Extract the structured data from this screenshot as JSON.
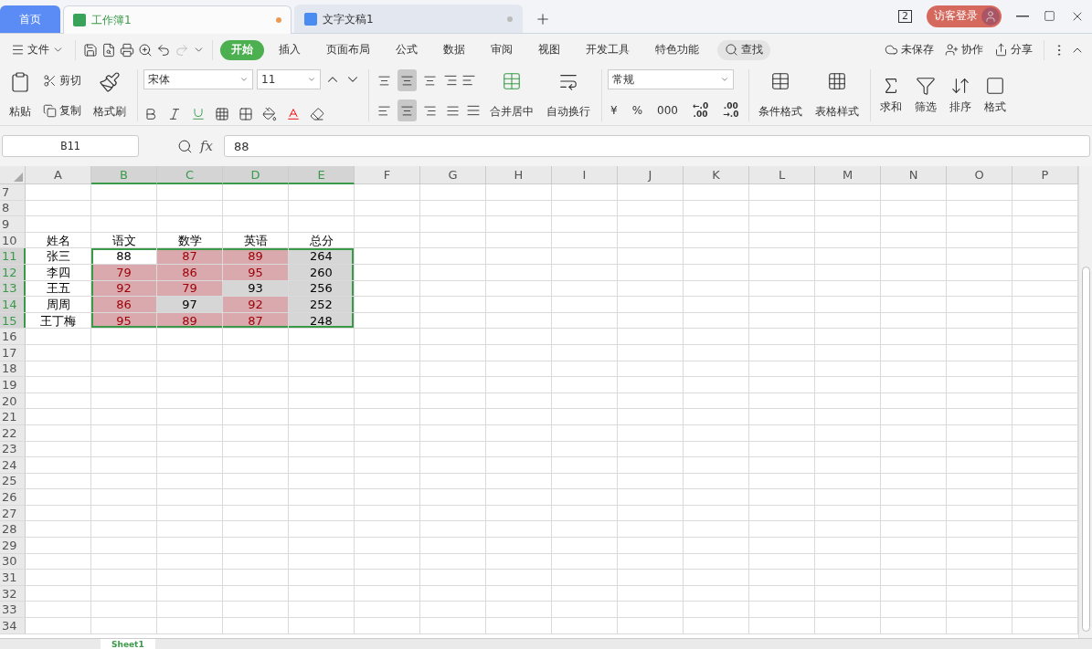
{
  "tabs": [
    {
      "kind": "home",
      "label": "首页",
      "selected": false
    },
    {
      "kind": "sheet",
      "label": "工作簿1",
      "selected": true,
      "unsaved": true
    },
    {
      "kind": "doc",
      "label": "文字文稿1",
      "selected": false,
      "unsaved": false
    }
  ],
  "window_count": "2",
  "login": "访客登录",
  "menu": {
    "file": "文件",
    "tabs": [
      {
        "label": "开始",
        "selected": true
      },
      {
        "label": "插入",
        "selected": false
      },
      {
        "label": "页面布局",
        "selected": false
      },
      {
        "label": "公式",
        "selected": false
      },
      {
        "label": "数据",
        "selected": false
      },
      {
        "label": "审阅",
        "selected": false
      },
      {
        "label": "视图",
        "selected": false
      },
      {
        "label": "开发工具",
        "selected": false
      },
      {
        "label": "特色功能",
        "selected": false
      }
    ],
    "search": "查找",
    "unsaved": "未保存",
    "collab": "协作",
    "share": "分享"
  },
  "toolbar": {
    "paste": "粘贴",
    "cut": "剪切",
    "copy": "复制",
    "format_painter": "格式刷",
    "font_name": "宋体",
    "font_size": "11",
    "vertical_align": [
      {
        "selected": false
      },
      {
        "selected": true
      },
      {
        "selected": false
      }
    ],
    "horizontal_align": [
      {
        "selected": false
      },
      {
        "selected": true
      },
      {
        "selected": false
      },
      {
        "selected": false
      }
    ],
    "merge": "合并居中",
    "wrap": "自动换行",
    "number_format": "常规",
    "number_buttons": [
      "¥",
      "%",
      "000"
    ],
    "decimals": [
      {
        "top": "←.0",
        "bottom": ".00"
      },
      {
        "top": ".00",
        "bottom": "→.0"
      }
    ],
    "cells": [
      "条件格式",
      "表格样式"
    ],
    "editing": [
      "求和",
      "筛选",
      "排序",
      "格式"
    ]
  },
  "formula_bar": {
    "cell": "B11",
    "fx": "fx",
    "value": "88"
  },
  "sheet": {
    "columns": [
      {
        "label": "A",
        "selected": false
      },
      {
        "label": "B",
        "selected": true
      },
      {
        "label": "C",
        "selected": true
      },
      {
        "label": "D",
        "selected": true
      },
      {
        "label": "E",
        "selected": true
      },
      {
        "label": "F",
        "selected": false
      },
      {
        "label": "G",
        "selected": false
      },
      {
        "label": "H",
        "selected": false
      },
      {
        "label": "I",
        "selected": false
      },
      {
        "label": "J",
        "selected": false
      },
      {
        "label": "K",
        "selected": false
      },
      {
        "label": "L",
        "selected": false
      },
      {
        "label": "M",
        "selected": false
      },
      {
        "label": "N",
        "selected": false
      },
      {
        "label": "O",
        "selected": false
      },
      {
        "label": "P",
        "selected": false
      }
    ],
    "rows": [
      {
        "label": "7",
        "selected": false
      },
      {
        "label": "8",
        "selected": false
      },
      {
        "label": "9",
        "selected": false
      },
      {
        "label": "10",
        "selected": false,
        "cells": [
          {
            "text": "姓名",
            "kind": "plain"
          },
          {
            "text": "语文",
            "kind": "plain"
          },
          {
            "text": "数学",
            "kind": "plain"
          },
          {
            "text": "英语",
            "kind": "plain"
          },
          {
            "text": "总分",
            "kind": "plain"
          }
        ]
      },
      {
        "label": "11",
        "selected": true,
        "cells": [
          {
            "text": "张三",
            "kind": "plain"
          },
          {
            "text": "88",
            "kind": "plain"
          },
          {
            "text": "87",
            "kind": "red"
          },
          {
            "text": "89",
            "kind": "red"
          },
          {
            "text": "264",
            "kind": "gray"
          }
        ]
      },
      {
        "label": "12",
        "selected": true,
        "cells": [
          {
            "text": "李四",
            "kind": "plain"
          },
          {
            "text": "79",
            "kind": "red"
          },
          {
            "text": "86",
            "kind": "red"
          },
          {
            "text": "95",
            "kind": "red"
          },
          {
            "text": "260",
            "kind": "gray"
          }
        ]
      },
      {
        "label": "13",
        "selected": true,
        "cells": [
          {
            "text": "王五",
            "kind": "plain"
          },
          {
            "text": "92",
            "kind": "red"
          },
          {
            "text": "79",
            "kind": "red"
          },
          {
            "text": "93",
            "kind": "gray"
          },
          {
            "text": "256",
            "kind": "gray"
          }
        ]
      },
      {
        "label": "14",
        "selected": true,
        "cells": [
          {
            "text": "周周",
            "kind": "plain"
          },
          {
            "text": "86",
            "kind": "red"
          },
          {
            "text": "97",
            "kind": "gray"
          },
          {
            "text": "92",
            "kind": "red"
          },
          {
            "text": "252",
            "kind": "gray"
          }
        ]
      },
      {
        "label": "15",
        "selected": true,
        "cells": [
          {
            "text": "王丁梅",
            "kind": "plain"
          },
          {
            "text": "95",
            "kind": "red"
          },
          {
            "text": "89",
            "kind": "red"
          },
          {
            "text": "87",
            "kind": "red"
          },
          {
            "text": "248",
            "kind": "gray"
          }
        ]
      },
      {
        "label": "16",
        "selected": false
      },
      {
        "label": "17",
        "selected": false
      },
      {
        "label": "18",
        "selected": false
      },
      {
        "label": "19",
        "selected": false
      },
      {
        "label": "20",
        "selected": false
      },
      {
        "label": "21",
        "selected": false
      },
      {
        "label": "22",
        "selected": false
      },
      {
        "label": "23",
        "selected": false
      },
      {
        "label": "24",
        "selected": false
      },
      {
        "label": "25",
        "selected": false
      },
      {
        "label": "26",
        "selected": false
      },
      {
        "label": "27",
        "selected": false
      },
      {
        "label": "28",
        "selected": false
      },
      {
        "label": "29",
        "selected": false
      },
      {
        "label": "30",
        "selected": false
      },
      {
        "label": "31",
        "selected": false
      },
      {
        "label": "32",
        "selected": false
      },
      {
        "label": "33",
        "selected": false
      },
      {
        "label": "34",
        "selected": false
      }
    ]
  },
  "sheet_tabs": [
    {
      "label": "Sheet1",
      "selected": true
    }
  ]
}
